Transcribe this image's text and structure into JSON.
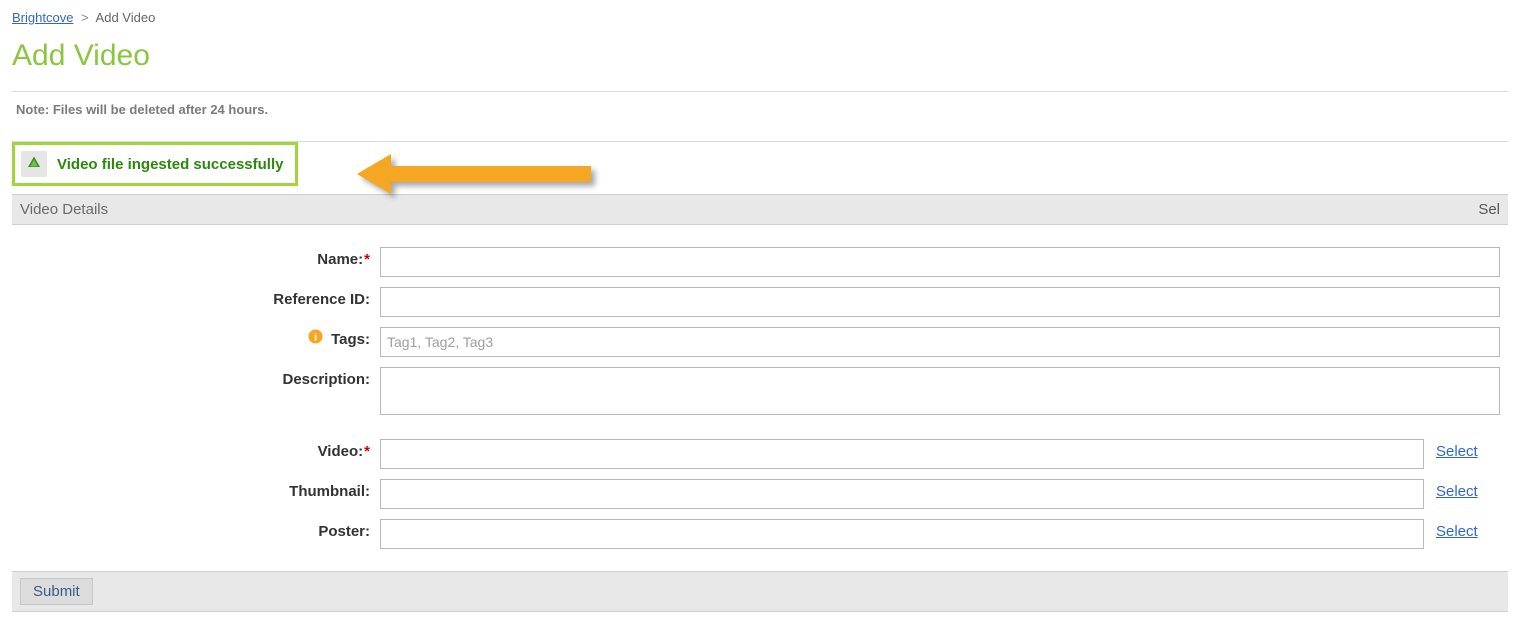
{
  "breadcrumb": {
    "root": "Brightcove",
    "sep": ">",
    "current": "Add Video"
  },
  "page_title": "Add Video",
  "note": "Note: Files will be deleted after 24 hours.",
  "success_message": "Video file ingested successfully",
  "section": {
    "title": "Video Details",
    "right": "Sel"
  },
  "labels": {
    "name": "Name:",
    "reference_id": "Reference ID:",
    "tags": "Tags:",
    "description": "Description:",
    "video": "Video:",
    "thumbnail": "Thumbnail:",
    "poster": "Poster:"
  },
  "required_mark": "*",
  "placeholders": {
    "tags": "Tag1, Tag2, Tag3"
  },
  "values": {
    "name": "",
    "reference_id": "",
    "tags": "",
    "description": "",
    "video": "",
    "thumbnail": "",
    "poster": ""
  },
  "links": {
    "select": "Select"
  },
  "buttons": {
    "submit": "Submit"
  },
  "colors": {
    "accent_green": "#8cc63f",
    "success_border": "#a0d639",
    "success_text": "#2b8a0b",
    "arrow": "#f5a623",
    "link": "#3366cc"
  }
}
